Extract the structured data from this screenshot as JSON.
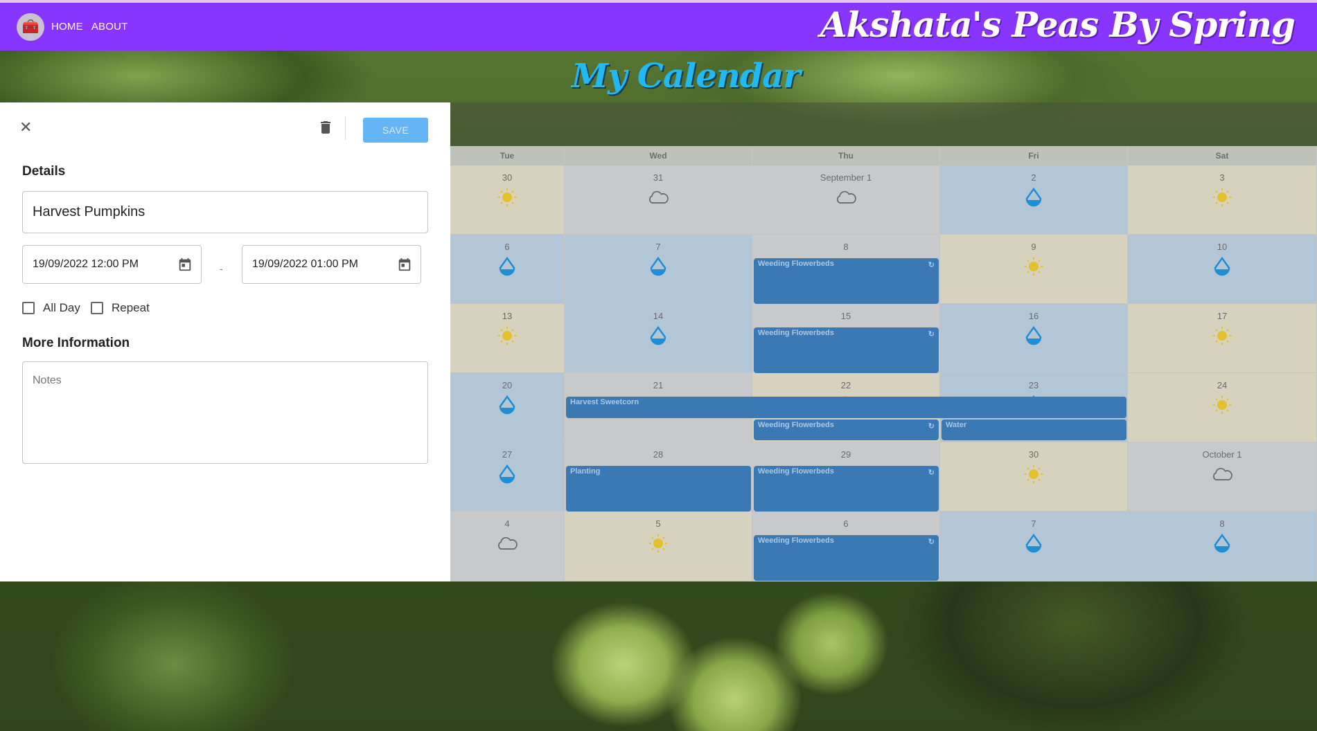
{
  "nav": {
    "home": "HOME",
    "about": "ABOUT",
    "brand": "Akshata's Peas By Spring"
  },
  "page": {
    "title": "My Calendar"
  },
  "editor": {
    "save_label": "SAVE",
    "details_label": "Details",
    "title_value": "Harvest Pumpkins",
    "start_value": "19/09/2022 12:00 PM",
    "end_value": "19/09/2022 01:00 PM",
    "dash": "-",
    "all_day_label": "All Day",
    "repeat_label": "Repeat",
    "more_info_label": "More Information",
    "notes_placeholder": "Notes"
  },
  "calendar": {
    "days": [
      "Tue",
      "Wed",
      "Thu",
      "Fri",
      "Sat"
    ],
    "weeks": [
      [
        {
          "d": "30",
          "w": "sun"
        },
        {
          "d": "31",
          "w": "cloud"
        },
        {
          "d": "September 1",
          "w": "cloud"
        },
        {
          "d": "2",
          "w": "rain"
        },
        {
          "d": "3",
          "w": "sun"
        }
      ],
      [
        {
          "d": "6",
          "w": "rain"
        },
        {
          "d": "7",
          "w": "rain"
        },
        {
          "d": "8",
          "w": "cloud"
        },
        {
          "d": "9",
          "w": "sun"
        },
        {
          "d": "10",
          "w": "rain"
        }
      ],
      [
        {
          "d": "13",
          "w": "sun"
        },
        {
          "d": "14",
          "w": "rain"
        },
        {
          "d": "15",
          "w": "cloud"
        },
        {
          "d": "16",
          "w": "rain"
        },
        {
          "d": "17",
          "w": "sun"
        }
      ],
      [
        {
          "d": "20",
          "w": "rain"
        },
        {
          "d": "21",
          "w": "cloud"
        },
        {
          "d": "22",
          "w": "sun"
        },
        {
          "d": "23",
          "w": "rain"
        },
        {
          "d": "24",
          "w": "sun"
        }
      ],
      [
        {
          "d": "27",
          "w": "rain"
        },
        {
          "d": "28",
          "w": "cloud"
        },
        {
          "d": "29",
          "w": "cloud"
        },
        {
          "d": "30",
          "w": "sun"
        },
        {
          "d": "October 1",
          "w": "cloud"
        }
      ],
      [
        {
          "d": "4",
          "w": "cloud"
        },
        {
          "d": "5",
          "w": "sun"
        },
        {
          "d": "6",
          "w": "cloud"
        },
        {
          "d": "7",
          "w": "rain"
        },
        {
          "d": "8",
          "w": "rain"
        }
      ]
    ],
    "events": [
      {
        "label": "Weeding Flowerbeds",
        "repeat": true
      },
      {
        "label": "Weeding Flowerbeds",
        "repeat": true
      },
      {
        "label": "Harvest Sweetcorn",
        "repeat": false
      },
      {
        "label": "Weeding Flowerbeds",
        "repeat": true
      },
      {
        "label": "Water",
        "repeat": false
      },
      {
        "label": "Planting",
        "repeat": false
      },
      {
        "label": "Weeding Flowerbeds",
        "repeat": true
      },
      {
        "label": "Weeding Flowerbeds",
        "repeat": true
      }
    ]
  },
  "colors": {
    "nav": "#8836ff",
    "event": "#3a79b3",
    "save": "#64b5f6"
  }
}
